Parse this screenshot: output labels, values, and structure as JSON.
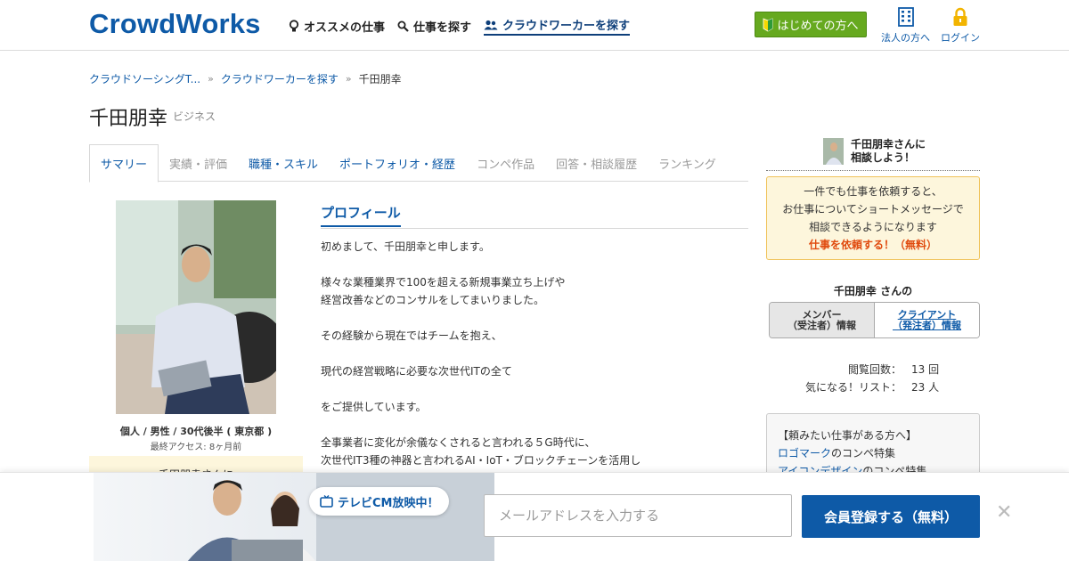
{
  "header": {
    "logo": "CrowdWorks",
    "nav": [
      {
        "label": "オススメの仕事"
      },
      {
        "label": "仕事を探す"
      },
      {
        "label": "クラウドワーカーを探す"
      }
    ],
    "first_time_button": "はじめての方へ",
    "corporate_label": "法人の方へ",
    "login_label": "ログイン"
  },
  "breadcrumb": [
    "クラウドソーシングT...",
    "クラウドワーカーを探す",
    "千田朋幸"
  ],
  "profile": {
    "name": "千田朋幸",
    "category": "ビジネス",
    "caption": "個人 / 男性 / 30代後半 ( 東京都 )",
    "last_access": "最終アクセス: 8ヶ月前",
    "left_box_text": "千田朋幸さんに"
  },
  "tabs": [
    {
      "label": "サマリー"
    },
    {
      "label": "実績・評価"
    },
    {
      "label": "職種・スキル"
    },
    {
      "label": "ポートフォリオ・経歴"
    },
    {
      "label": "コンペ作品"
    },
    {
      "label": "回答・相談履歴"
    },
    {
      "label": "ランキング"
    }
  ],
  "profile_section": {
    "heading": "プロフィール",
    "lines": [
      "初めまして、千田朋幸と申します。",
      "",
      "様々な業種業界で100を超える新規事業立ち上げや",
      "経営改善などのコンサルをしてまいりました。",
      "",
      "その経験から現在ではチームを抱え、",
      "",
      "現代の経営戦略に必要な次世代ITの全て",
      "",
      "をご提供しています。",
      "",
      "全事業者に変化が余儀なくされると言われる５G時代に、",
      "次世代IT3種の神器と言われるAI・IoT・ブロックチェーンを活用し"
    ]
  },
  "sidebar": {
    "consult_title_line1": "千田朋幸さんに",
    "consult_title_line2": "相談しよう！",
    "info_lines": [
      "一件でも仕事を依頼すると、",
      "お仕事についてショートメッセージで",
      "相談できるようになります"
    ],
    "request_link": "仕事を依頼する！（無料）",
    "member_title": "千田朋幸 さんの",
    "member_tab": {
      "line1": "メンバー",
      "line2": "（受注者）情報"
    },
    "client_tab": {
      "line1": "クライアント",
      "line2": "（発注者）情報"
    },
    "stats": [
      {
        "label": "閲覧回数：",
        "value": "13 回"
      },
      {
        "label": "気になる！リスト：",
        "value": "23 人"
      }
    ],
    "side_box": {
      "title": "【頼みたい仕事がある方へ】",
      "link1": "ロゴマーク",
      "link1_suffix": "のコンペ特集",
      "link2": "アイコンデザイン",
      "link2_suffix": "のコンペ特集"
    }
  },
  "cta": {
    "tv_label": "テレビCM放映中！",
    "email_placeholder": "メールアドレスを入力する",
    "register_button": "会員登録する（無料）",
    "close": "✕"
  },
  "colors": {
    "brand": "#0e5aa7",
    "green": "#66a91f",
    "notice_bg": "#fdf6dc",
    "notice_border": "#f0c35a",
    "accent_red": "#e04a0e"
  }
}
